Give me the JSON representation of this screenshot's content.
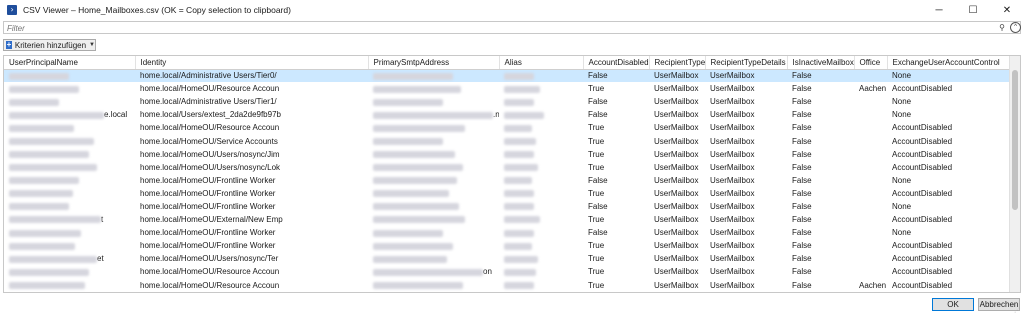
{
  "window": {
    "app_icon": "powershell-icon",
    "title": "CSV Viewer – Home_Mailboxes.csv  (OK = Copy selection to clipboard)",
    "controls": {
      "minimize": "─",
      "maximize": "☐",
      "close": "✕"
    }
  },
  "filter": {
    "placeholder": "Filter",
    "search_icon": "⚲",
    "collapse_icon": "^"
  },
  "criteria": {
    "plus": "+",
    "label": "Kriterien hinzufügen",
    "caret": "▼"
  },
  "table": {
    "columns": [
      "UserPrincipalName",
      "Identity",
      "PrimarySmtpAddress",
      "Alias",
      "AccountDisabled",
      "RecipientType",
      "RecipientTypeDetails",
      "IsInactiveMailbox",
      "Office",
      "ExchangeUserAccountControl"
    ],
    "rows": [
      {
        "upn": "",
        "identity": "home.local/Administrative Users/Tier0/",
        "smtp": "",
        "alias": "",
        "disabled": "False",
        "rtype": "UserMailbox",
        "rdetails": "UserMailbox",
        "inactive": "False",
        "office": "",
        "uac": "None"
      },
      {
        "upn": "",
        "identity": "home.local/HomeOU/Resource Accoun",
        "smtp": "",
        "alias": "",
        "disabled": "True",
        "rtype": "UserMailbox",
        "rdetails": "UserMailbox",
        "inactive": "False",
        "office": "Aachen",
        "uac": "AccountDisabled"
      },
      {
        "upn": "",
        "identity": "home.local/Administrative Users/Tier1/",
        "smtp": "",
        "alias": "",
        "disabled": "False",
        "rtype": "UserMailbox",
        "rdetails": "UserMailbox",
        "inactive": "False",
        "office": "",
        "uac": "None"
      },
      {
        "upn": "e.local",
        "identity": "home.local/Users/extest_2da2de9fb97b",
        "smtp": ".net",
        "alias": "",
        "disabled": "False",
        "rtype": "UserMailbox",
        "rdetails": "UserMailbox",
        "inactive": "False",
        "office": "",
        "uac": "None"
      },
      {
        "upn": "",
        "identity": "home.local/HomeOU/Resource Accoun",
        "smtp": "",
        "alias": "",
        "disabled": "True",
        "rtype": "UserMailbox",
        "rdetails": "UserMailbox",
        "inactive": "False",
        "office": "",
        "uac": "AccountDisabled"
      },
      {
        "upn": "",
        "identity": "home.local/HomeOU/Service Accounts",
        "smtp": "",
        "alias": "",
        "disabled": "True",
        "rtype": "UserMailbox",
        "rdetails": "UserMailbox",
        "inactive": "False",
        "office": "",
        "uac": "AccountDisabled"
      },
      {
        "upn": "",
        "identity": "home.local/HomeOU/Users/nosync/Jim",
        "smtp": "",
        "alias": "",
        "disabled": "True",
        "rtype": "UserMailbox",
        "rdetails": "UserMailbox",
        "inactive": "False",
        "office": "",
        "uac": "AccountDisabled"
      },
      {
        "upn": "",
        "identity": "home.local/HomeOU/Users/nosync/Lok",
        "smtp": "",
        "alias": "",
        "disabled": "True",
        "rtype": "UserMailbox",
        "rdetails": "UserMailbox",
        "inactive": "False",
        "office": "",
        "uac": "AccountDisabled"
      },
      {
        "upn": "",
        "identity": "home.local/HomeOU/Frontline Worker",
        "smtp": "",
        "alias": "",
        "disabled": "False",
        "rtype": "UserMailbox",
        "rdetails": "UserMailbox",
        "inactive": "False",
        "office": "",
        "uac": "None"
      },
      {
        "upn": "",
        "identity": "home.local/HomeOU/Frontline Worker",
        "smtp": "",
        "alias": "",
        "disabled": "True",
        "rtype": "UserMailbox",
        "rdetails": "UserMailbox",
        "inactive": "False",
        "office": "",
        "uac": "AccountDisabled"
      },
      {
        "upn": "",
        "identity": "home.local/HomeOU/Frontline Worker",
        "smtp": "",
        "alias": "",
        "disabled": "False",
        "rtype": "UserMailbox",
        "rdetails": "UserMailbox",
        "inactive": "False",
        "office": "",
        "uac": "None"
      },
      {
        "upn": "t",
        "identity": "home.local/HomeOU/External/New Emp",
        "smtp": "",
        "alias": "",
        "disabled": "True",
        "rtype": "UserMailbox",
        "rdetails": "UserMailbox",
        "inactive": "False",
        "office": "",
        "uac": "AccountDisabled"
      },
      {
        "upn": "",
        "identity": "home.local/HomeOU/Frontline Worker",
        "smtp": "",
        "alias": "",
        "disabled": "False",
        "rtype": "UserMailbox",
        "rdetails": "UserMailbox",
        "inactive": "False",
        "office": "",
        "uac": "None"
      },
      {
        "upn": "",
        "identity": "home.local/HomeOU/Frontline Worker",
        "smtp": "",
        "alias": "",
        "disabled": "True",
        "rtype": "UserMailbox",
        "rdetails": "UserMailbox",
        "inactive": "False",
        "office": "",
        "uac": "AccountDisabled"
      },
      {
        "upn": "et",
        "identity": "home.local/HomeOU/Users/nosync/Ter",
        "smtp": "",
        "alias": "",
        "disabled": "True",
        "rtype": "UserMailbox",
        "rdetails": "UserMailbox",
        "inactive": "False",
        "office": "",
        "uac": "AccountDisabled"
      },
      {
        "upn": "",
        "identity": "home.local/HomeOU/Resource Accoun",
        "smtp": "on",
        "alias": "",
        "disabled": "True",
        "rtype": "UserMailbox",
        "rdetails": "UserMailbox",
        "inactive": "False",
        "office": "",
        "uac": "AccountDisabled"
      },
      {
        "upn": "",
        "identity": "home.local/HomeOU/Resource Accoun",
        "smtp": "",
        "alias": "",
        "disabled": "True",
        "rtype": "UserMailbox",
        "rdetails": "UserMailbox",
        "inactive": "False",
        "office": "Aachen",
        "uac": "AccountDisabled"
      }
    ]
  },
  "buttons": {
    "ok": "OK",
    "cancel": "Abbrechen"
  }
}
